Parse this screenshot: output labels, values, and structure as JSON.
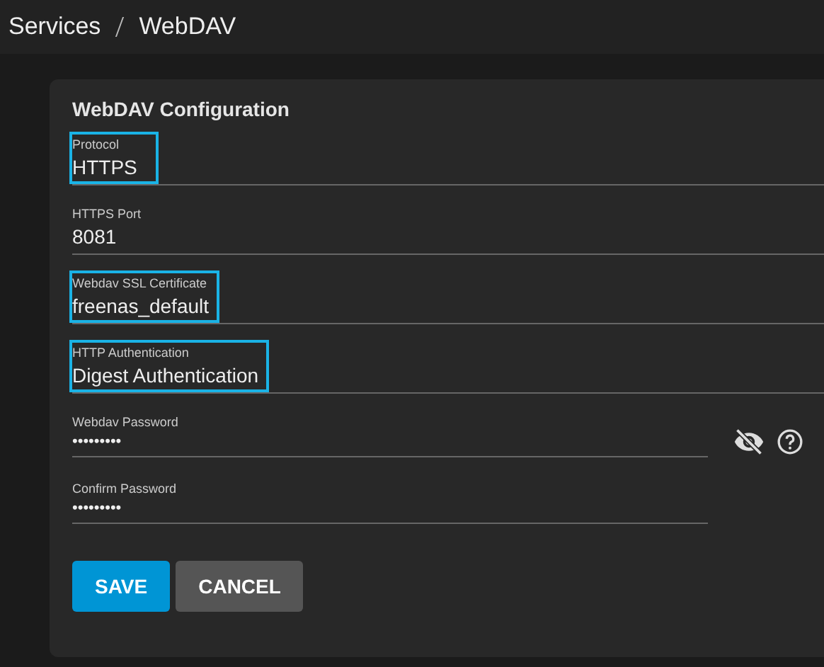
{
  "breadcrumb": [
    "Services",
    "WebDAV"
  ],
  "card": {
    "title": "WebDAV Configuration"
  },
  "fields": [
    {
      "kind": "text",
      "label": "Protocol",
      "value": "HTTPS",
      "highlighted": true
    },
    {
      "kind": "text",
      "label": "HTTPS Port",
      "value": "8081",
      "highlighted": false
    },
    {
      "kind": "text",
      "label": "Webdav SSL Certificate",
      "value": "freenas_default",
      "highlighted": true
    },
    {
      "kind": "text",
      "label": "HTTP Authentication",
      "value": "Digest Authentication",
      "highlighted": true
    },
    {
      "kind": "password",
      "label": "Webdav Password",
      "value": "•••••••••",
      "highlighted": false
    },
    {
      "kind": "password_confirm",
      "label": "Confirm Password",
      "value": "•••••••••",
      "highlighted": false
    }
  ],
  "buttons": [
    {
      "label": "SAVE",
      "kind": "primary"
    },
    {
      "label": "CANCEL",
      "kind": "secondary"
    }
  ]
}
